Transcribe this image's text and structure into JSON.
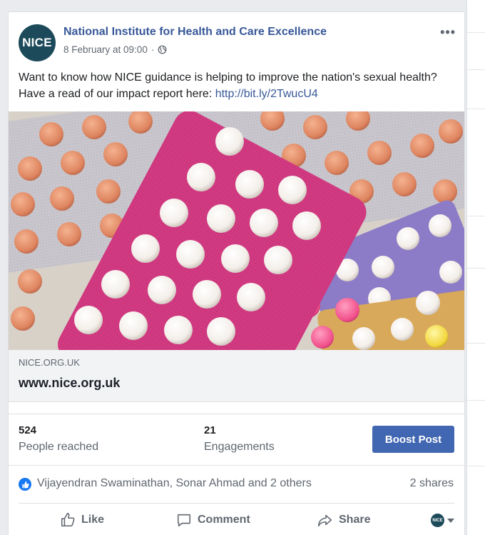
{
  "post": {
    "page_name": "National Institute for Health and Care Excellence",
    "avatar_text": "NICE",
    "timestamp": "8 February at 09:00",
    "separator": "·",
    "more_label": "•••",
    "text_before_link": "Want to know how NICE guidance is helping to improve the nation's sexual health? Have a read of our impact report here: ",
    "link": "http://bit.ly/2TwucU4"
  },
  "link_preview": {
    "domain": "NICE.ORG.UK",
    "title": "www.nice.org.uk"
  },
  "stats": {
    "reached_count": "524",
    "reached_label": "People reached",
    "engagements_count": "21",
    "engagements_label": "Engagements",
    "boost_label": "Boost Post"
  },
  "reactions": {
    "names": "Vijayendran Swaminathan, Sonar Ahmad and 2 others",
    "shares": "2 shares"
  },
  "actions": {
    "like": "Like",
    "comment": "Comment",
    "share": "Share",
    "page_avatar_text": "NICE"
  },
  "colors": {
    "link_blue": "#385898",
    "boost_blue": "#4267b2",
    "avatar_teal": "#1c4a5a",
    "pill_pack_pink": "#d6337e"
  },
  "icons": [
    "globe-icon",
    "more-options-icon",
    "like-reaction-icon",
    "like-icon",
    "comment-icon",
    "share-icon",
    "chevron-down-icon"
  ]
}
